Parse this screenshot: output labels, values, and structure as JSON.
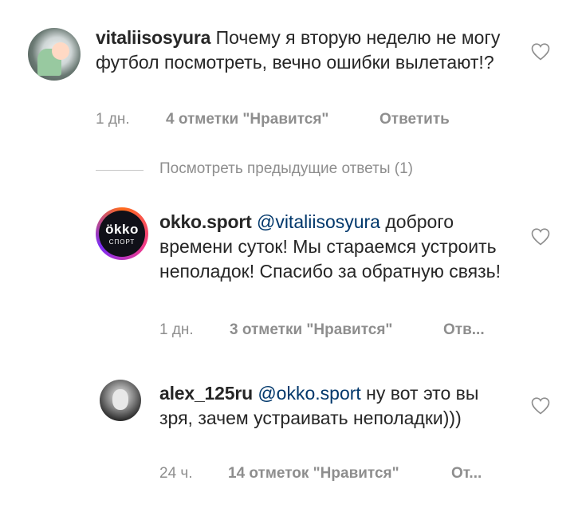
{
  "comments": [
    {
      "username": "vitaliisosyura",
      "text": " Почему я вторую неделю не могу футбол посмотреть, вечно ошибки вылетают!?",
      "mention": "",
      "time": "1 дн.",
      "likes": "4 отметки \"Нравится\"",
      "reply_label": "Ответить"
    },
    {
      "username": "okko.sport",
      "mention": "@vitaliisosyura",
      "text": " доброго времени суток! Мы стараемся устроить неполадок! Спасибо за обратную связь!",
      "time": "1 дн.",
      "likes": "3 отметки \"Нравится\"",
      "reply_label": "Отв..."
    },
    {
      "username": "alex_125ru",
      "mention": "@okko.sport",
      "text": " ну вот это вы зря, зачем устраивать неполадки)))",
      "time": "24 ч.",
      "likes": "14 отметок \"Нравится\"",
      "reply_label": "От..."
    }
  ],
  "avatar_okko": {
    "brand": "ökko",
    "sub": "СПОРТ"
  },
  "view_previous_replies": "Посмотреть предыдущие ответы (1)",
  "icons": {
    "like": "heart-outline-icon"
  },
  "colors": {
    "text": "#262626",
    "meta": "#8e8e8e",
    "mention": "#00376b"
  }
}
